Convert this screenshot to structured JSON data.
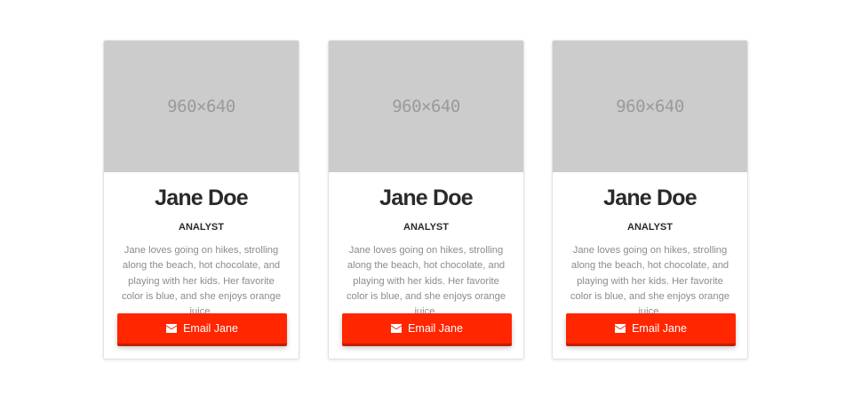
{
  "cards": [
    {
      "image_placeholder": "960×640",
      "name": "Jane Doe",
      "role": "ANALYST",
      "bio": "Jane loves going on hikes, strolling along the beach, hot chocolate, and playing with her kids. Her favorite color is blue, and she enjoys orange juice.",
      "button_label": "Email Jane",
      "button_icon": "envelope-icon"
    },
    {
      "image_placeholder": "960×640",
      "name": "Jane Doe",
      "role": "ANALYST",
      "bio": "Jane loves going on hikes, strolling along the beach, hot chocolate, and playing with her kids. Her favorite color is blue, and she enjoys orange juice.",
      "button_label": "Email Jane",
      "button_icon": "envelope-icon"
    },
    {
      "image_placeholder": "960×640",
      "name": "Jane Doe",
      "role": "ANALYST",
      "bio": "Jane loves going on hikes, strolling along the beach, hot chocolate, and playing with her kids. Her favorite color is blue, and she enjoys orange juice.",
      "button_label": "Email Jane",
      "button_icon": "envelope-icon"
    }
  ],
  "colors": {
    "button": "#ff2600",
    "placeholder": "#cccccc",
    "name": "#2a2a2a",
    "bio": "#8c8c8c"
  }
}
